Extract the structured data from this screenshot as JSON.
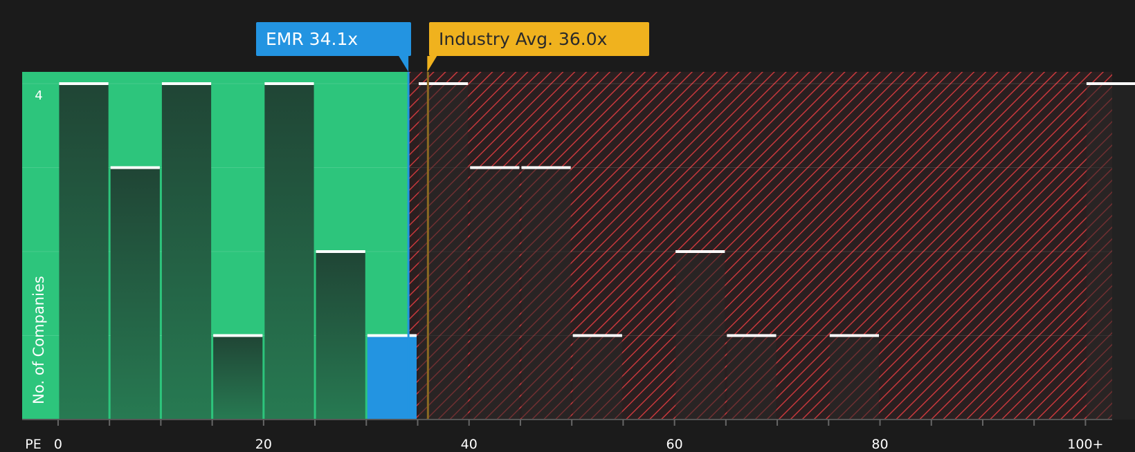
{
  "chart_data": {
    "type": "bar",
    "ylabel": "No. of Companies",
    "xlabel": "PE",
    "bin_width": 5,
    "bins_start": [
      0,
      5,
      10,
      15,
      20,
      25,
      30,
      35,
      40,
      45,
      50,
      55,
      60,
      65,
      70,
      75,
      80,
      85,
      90,
      95,
      100
    ],
    "values": [
      4,
      3,
      4,
      1,
      4,
      2,
      1,
      4,
      3,
      3,
      1,
      0,
      2,
      1,
      0,
      1,
      0,
      0,
      0,
      0,
      4
    ],
    "highlight_bin": 30,
    "xlim": [
      -3.5,
      102.6
    ],
    "ylim": [
      0,
      4.14
    ],
    "y_tick_label": "4",
    "x_ticks": [
      {
        "value": 0,
        "label": "0"
      },
      {
        "value": 20,
        "label": "20"
      },
      {
        "value": 40,
        "label": "40"
      },
      {
        "value": 60,
        "label": "60"
      },
      {
        "value": 80,
        "label": "80"
      },
      {
        "value": 100,
        "label": "100+"
      }
    ],
    "company": {
      "ticker": "EMR",
      "pe": 34.1,
      "label": "EMR 34.1x"
    },
    "industry": {
      "pe": 36.0,
      "label": "Industry Avg. 36.0x"
    },
    "colors": {
      "background": "#1b1b1b",
      "undervalued_zone": "#2dc57c",
      "overvalued_hatch": "#c8383c",
      "company": "#2394e1",
      "industry": "#f0b21e",
      "bar_cap": "#ffffff"
    }
  }
}
